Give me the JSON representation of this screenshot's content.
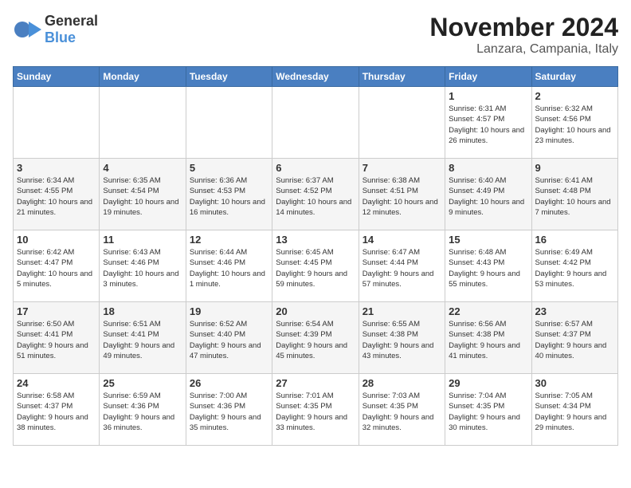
{
  "header": {
    "logo_general": "General",
    "logo_blue": "Blue",
    "month_title": "November 2024",
    "location": "Lanzara, Campania, Italy"
  },
  "days_of_week": [
    "Sunday",
    "Monday",
    "Tuesday",
    "Wednesday",
    "Thursday",
    "Friday",
    "Saturday"
  ],
  "weeks": [
    [
      {
        "day": "",
        "info": ""
      },
      {
        "day": "",
        "info": ""
      },
      {
        "day": "",
        "info": ""
      },
      {
        "day": "",
        "info": ""
      },
      {
        "day": "",
        "info": ""
      },
      {
        "day": "1",
        "info": "Sunrise: 6:31 AM\nSunset: 4:57 PM\nDaylight: 10 hours and 26 minutes."
      },
      {
        "day": "2",
        "info": "Sunrise: 6:32 AM\nSunset: 4:56 PM\nDaylight: 10 hours and 23 minutes."
      }
    ],
    [
      {
        "day": "3",
        "info": "Sunrise: 6:34 AM\nSunset: 4:55 PM\nDaylight: 10 hours and 21 minutes."
      },
      {
        "day": "4",
        "info": "Sunrise: 6:35 AM\nSunset: 4:54 PM\nDaylight: 10 hours and 19 minutes."
      },
      {
        "day": "5",
        "info": "Sunrise: 6:36 AM\nSunset: 4:53 PM\nDaylight: 10 hours and 16 minutes."
      },
      {
        "day": "6",
        "info": "Sunrise: 6:37 AM\nSunset: 4:52 PM\nDaylight: 10 hours and 14 minutes."
      },
      {
        "day": "7",
        "info": "Sunrise: 6:38 AM\nSunset: 4:51 PM\nDaylight: 10 hours and 12 minutes."
      },
      {
        "day": "8",
        "info": "Sunrise: 6:40 AM\nSunset: 4:49 PM\nDaylight: 10 hours and 9 minutes."
      },
      {
        "day": "9",
        "info": "Sunrise: 6:41 AM\nSunset: 4:48 PM\nDaylight: 10 hours and 7 minutes."
      }
    ],
    [
      {
        "day": "10",
        "info": "Sunrise: 6:42 AM\nSunset: 4:47 PM\nDaylight: 10 hours and 5 minutes."
      },
      {
        "day": "11",
        "info": "Sunrise: 6:43 AM\nSunset: 4:46 PM\nDaylight: 10 hours and 3 minutes."
      },
      {
        "day": "12",
        "info": "Sunrise: 6:44 AM\nSunset: 4:46 PM\nDaylight: 10 hours and 1 minute."
      },
      {
        "day": "13",
        "info": "Sunrise: 6:45 AM\nSunset: 4:45 PM\nDaylight: 9 hours and 59 minutes."
      },
      {
        "day": "14",
        "info": "Sunrise: 6:47 AM\nSunset: 4:44 PM\nDaylight: 9 hours and 57 minutes."
      },
      {
        "day": "15",
        "info": "Sunrise: 6:48 AM\nSunset: 4:43 PM\nDaylight: 9 hours and 55 minutes."
      },
      {
        "day": "16",
        "info": "Sunrise: 6:49 AM\nSunset: 4:42 PM\nDaylight: 9 hours and 53 minutes."
      }
    ],
    [
      {
        "day": "17",
        "info": "Sunrise: 6:50 AM\nSunset: 4:41 PM\nDaylight: 9 hours and 51 minutes."
      },
      {
        "day": "18",
        "info": "Sunrise: 6:51 AM\nSunset: 4:41 PM\nDaylight: 9 hours and 49 minutes."
      },
      {
        "day": "19",
        "info": "Sunrise: 6:52 AM\nSunset: 4:40 PM\nDaylight: 9 hours and 47 minutes."
      },
      {
        "day": "20",
        "info": "Sunrise: 6:54 AM\nSunset: 4:39 PM\nDaylight: 9 hours and 45 minutes."
      },
      {
        "day": "21",
        "info": "Sunrise: 6:55 AM\nSunset: 4:38 PM\nDaylight: 9 hours and 43 minutes."
      },
      {
        "day": "22",
        "info": "Sunrise: 6:56 AM\nSunset: 4:38 PM\nDaylight: 9 hours and 41 minutes."
      },
      {
        "day": "23",
        "info": "Sunrise: 6:57 AM\nSunset: 4:37 PM\nDaylight: 9 hours and 40 minutes."
      }
    ],
    [
      {
        "day": "24",
        "info": "Sunrise: 6:58 AM\nSunset: 4:37 PM\nDaylight: 9 hours and 38 minutes."
      },
      {
        "day": "25",
        "info": "Sunrise: 6:59 AM\nSunset: 4:36 PM\nDaylight: 9 hours and 36 minutes."
      },
      {
        "day": "26",
        "info": "Sunrise: 7:00 AM\nSunset: 4:36 PM\nDaylight: 9 hours and 35 minutes."
      },
      {
        "day": "27",
        "info": "Sunrise: 7:01 AM\nSunset: 4:35 PM\nDaylight: 9 hours and 33 minutes."
      },
      {
        "day": "28",
        "info": "Sunrise: 7:03 AM\nSunset: 4:35 PM\nDaylight: 9 hours and 32 minutes."
      },
      {
        "day": "29",
        "info": "Sunrise: 7:04 AM\nSunset: 4:35 PM\nDaylight: 9 hours and 30 minutes."
      },
      {
        "day": "30",
        "info": "Sunrise: 7:05 AM\nSunset: 4:34 PM\nDaylight: 9 hours and 29 minutes."
      }
    ]
  ]
}
